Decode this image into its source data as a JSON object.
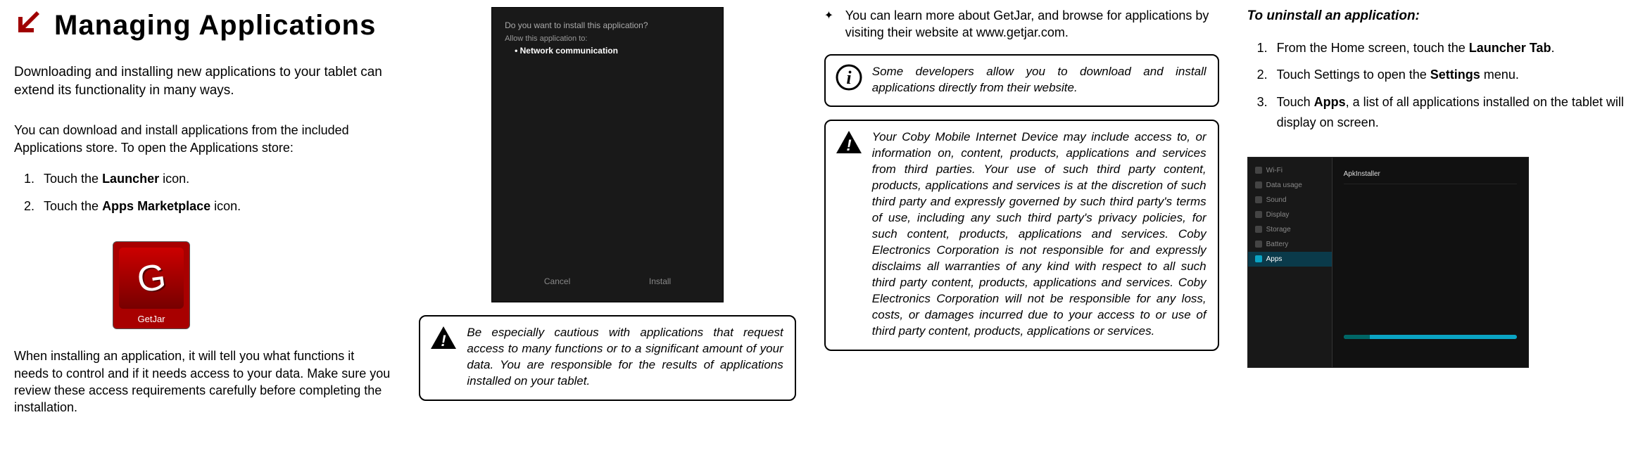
{
  "heading": "Managing Applications",
  "subtitle": "Downloading and installing new applications to your tablet can extend its functionality in many ways.",
  "col1": {
    "p1": "You can download and install applications from the included Applications store. To open the Applications store:",
    "li1_pre": "Touch the ",
    "li1_bold": "Launcher",
    "li1_post": " icon.",
    "li2_pre": "Touch the ",
    "li2_bold": "Apps Marketplace",
    "li2_post": " icon.",
    "getjar_label": "GetJar",
    "p2": "When installing an application, it will tell you what functions it needs to control and if it needs access to your data. Make sure you review these access requirements carefully before completing the installation."
  },
  "col2": {
    "shot_top": "Do you want to install this application?",
    "shot_line": "Allow this application to:",
    "shot_bullet": "Network communication",
    "shot_btn1": "Cancel",
    "shot_btn2": "Install",
    "warn1": "Be especially cautious with applications that request access to many functions or to a signiﬁcant amount of your data. You are responsible for the results of applications installed on your tablet."
  },
  "col3": {
    "diamond_text": "You can learn more about GetJar, and browse for applications by visiting their website at www.getjar.com.",
    "info1": "Some developers allow you to download and install applications directly from their website.",
    "warn2": "Your Coby Mobile Internet Device may include access to, or information on, content, products, applications and services from third parties. Your use of such third party content, products, applications and services is at the discretion of such third party and expressly governed by such third party's terms of use, including any such third party's privacy policies, for such content, products, applications and services. Coby Electronics Corporation is not responsible for and expressly disclaims all warranties of any kind with respect to all such third party content, products, applications and services. Coby Electronics Corporation will not be responsible for any loss, costs, or damages incurred due to your access to or use of third party content, products, applications or services."
  },
  "col4": {
    "subhead": "To uninstall an application:",
    "li1_pre": "From the Home screen, touch the ",
    "li1_bold": "Launcher Tab",
    "li1_post": ".",
    "li2_pre": "Touch Settings to open the ",
    "li2_bold": "Settings",
    "li2_post": " menu.",
    "li3_pre": "Touch ",
    "li3_bold": "Apps",
    "li3_post": ", a list of all applications installed on the tablet will display on screen.",
    "ss2": {
      "items": [
        "Wi-Fi",
        "Data usage",
        "Sound",
        "Display",
        "Storage",
        "Battery"
      ],
      "selected": "Apps",
      "right_item": "ApkInstaller"
    }
  }
}
